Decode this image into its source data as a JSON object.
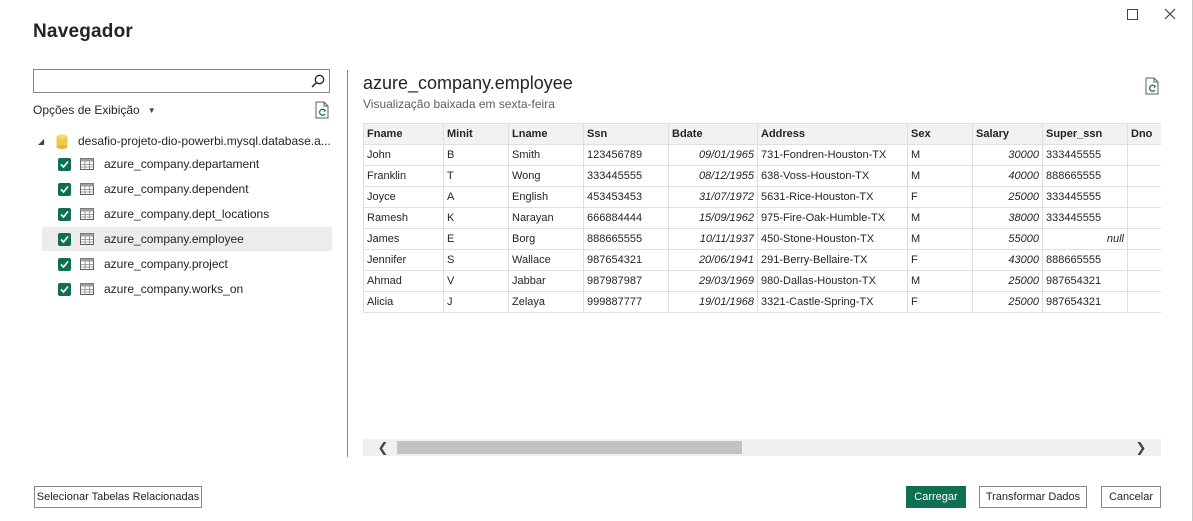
{
  "dialog": {
    "title": "Navegador"
  },
  "window_controls": {
    "maximize_icon": "maximize-icon",
    "close_icon": "close-icon"
  },
  "left_pane": {
    "search_value": "",
    "search_placeholder": "",
    "view_options_label": "Opções de Exibição",
    "root": {
      "label": "desafio-projeto-dio-powerbi.mysql.database.a...",
      "expanded": true
    },
    "items": [
      {
        "label": "azure_company.departament",
        "checked": true,
        "selected": false
      },
      {
        "label": "azure_company.dependent",
        "checked": true,
        "selected": false
      },
      {
        "label": "azure_company.dept_locations",
        "checked": true,
        "selected": false
      },
      {
        "label": "azure_company.employee",
        "checked": true,
        "selected": true
      },
      {
        "label": "azure_company.project",
        "checked": true,
        "selected": false
      },
      {
        "label": "azure_company.works_on",
        "checked": true,
        "selected": false
      }
    ]
  },
  "preview": {
    "title": "azure_company.employee",
    "subtitle": "Visualização baixada em sexta-feira",
    "columns": [
      "Fname",
      "Minit",
      "Lname",
      "Ssn",
      "Bdate",
      "Address",
      "Sex",
      "Salary",
      "Super_ssn",
      "Dno"
    ],
    "rows": [
      [
        "John",
        "B",
        "Smith",
        "123456789",
        "09/01/1965",
        "731-Fondren-Houston-TX",
        "M",
        "30000",
        "333445555",
        ""
      ],
      [
        "Franklin",
        "T",
        "Wong",
        "333445555",
        "08/12/1955",
        "638-Voss-Houston-TX",
        "M",
        "40000",
        "888665555",
        ""
      ],
      [
        "Joyce",
        "A",
        "English",
        "453453453",
        "31/07/1972",
        "5631-Rice-Houston-TX",
        "F",
        "25000",
        "333445555",
        ""
      ],
      [
        "Ramesh",
        "K",
        "Narayan",
        "666884444",
        "15/09/1962",
        "975-Fire-Oak-Humble-TX",
        "M",
        "38000",
        "333445555",
        ""
      ],
      [
        "James",
        "E",
        "Borg",
        "888665555",
        "10/11/1937",
        "450-Stone-Houston-TX",
        "M",
        "55000",
        "null",
        ""
      ],
      [
        "Jennifer",
        "S",
        "Wallace",
        "987654321",
        "20/06/1941",
        "291-Berry-Bellaire-TX",
        "F",
        "43000",
        "888665555",
        ""
      ],
      [
        "Ahmad",
        "V",
        "Jabbar",
        "987987987",
        "29/03/1969",
        "980-Dallas-Houston-TX",
        "M",
        "25000",
        "987654321",
        ""
      ],
      [
        "Alicia",
        "J",
        "Zelaya",
        "999887777",
        "19/01/1968",
        "3321-Castle-Spring-TX",
        "F",
        "25000",
        "987654321",
        ""
      ]
    ]
  },
  "footer": {
    "related_tables_label": "Selecionar Tabelas Relacionadas",
    "load_label": "Carregar",
    "transform_label": "Transformar Dados",
    "cancel_label": "Cancelar"
  },
  "colors": {
    "accent": "#0e6f52",
    "header_bg": "#f3f2f1",
    "selected_bg": "#ececec"
  }
}
